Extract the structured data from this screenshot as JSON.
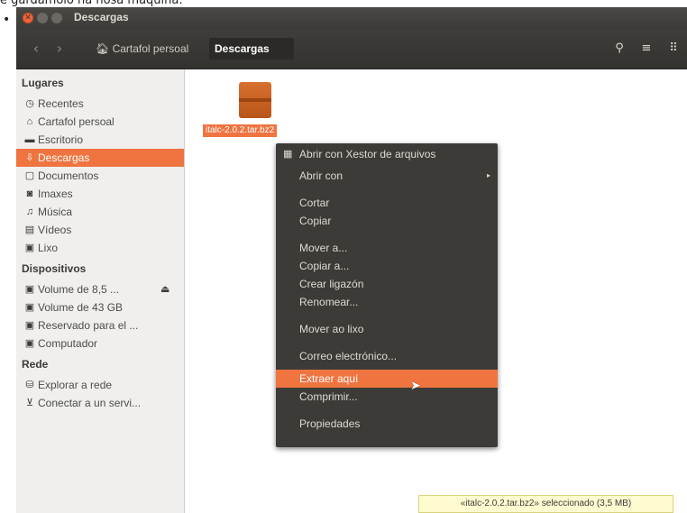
{
  "caption": "e gardámolo na nosa máquina.",
  "bullet": "•",
  "window": {
    "title": "Descargas"
  },
  "toolbar": {
    "back_icon": "chevron-left-icon",
    "forward_icon": "chevron-right-icon",
    "crumb_home": "Cartafol persoal",
    "crumb_current": "Descargas",
    "search_icon": "search-icon",
    "list_view_icon": "menu-icon",
    "grid_view_icon": "grid-icon"
  },
  "sidebar": {
    "section_places": "Lugares",
    "places": [
      {
        "label": "Recentes",
        "icon": "clock-icon"
      },
      {
        "label": "Cartafol persoal",
        "icon": "home-icon"
      },
      {
        "label": "Escritorio",
        "icon": "desktop-icon"
      },
      {
        "label": "Descargas",
        "icon": "download-icon"
      },
      {
        "label": "Documentos",
        "icon": "document-icon"
      },
      {
        "label": "Imaxes",
        "icon": "camera-icon"
      },
      {
        "label": "Música",
        "icon": "music-icon"
      },
      {
        "label": "Vídeos",
        "icon": "video-icon"
      },
      {
        "label": "Lixo",
        "icon": "trash-icon"
      }
    ],
    "section_devices": "Dispositivos",
    "devices": [
      {
        "label": "Volume de 8,5 ...",
        "icon": "drive-icon",
        "eject": "⏏"
      },
      {
        "label": "Volume de 43 GB",
        "icon": "drive-icon"
      },
      {
        "label": "Reservado para el ...",
        "icon": "drive-icon"
      },
      {
        "label": "Computador",
        "icon": "drive-icon"
      }
    ],
    "section_network": "Rede",
    "network": [
      {
        "label": "Explorar a rede",
        "icon": "network-icon"
      },
      {
        "label": "Conectar a un servi...",
        "icon": "server-icon"
      }
    ]
  },
  "file": {
    "name": "italc-2.0.2.tar.bz2",
    "icon": "archive-icon"
  },
  "context_menu": {
    "items": [
      {
        "label": "Abrir con Xestor de arquivos",
        "icon": "archive-manager-icon"
      },
      {
        "label": "Abrir con"
      },
      {
        "label": "Cortar"
      },
      {
        "label": "Copiar"
      },
      {
        "label": "Mover a..."
      },
      {
        "label": "Copiar a..."
      },
      {
        "label": "Crear ligazón"
      },
      {
        "label": "Renomear..."
      },
      {
        "label": "Mover ao lixo"
      },
      {
        "label": "Correo electrónico..."
      },
      {
        "label": "Extraer aquí"
      },
      {
        "label": "Comprimir..."
      },
      {
        "label": "Propiedades"
      }
    ],
    "submenu_arrow": "▸"
  },
  "status": "«italc-2.0.2.tar.bz2» seleccionado (3,5 MB)",
  "colors": {
    "accent": "#ef7440",
    "menu_bg": "#3c3b37",
    "titlebar": "#3c3b37"
  }
}
